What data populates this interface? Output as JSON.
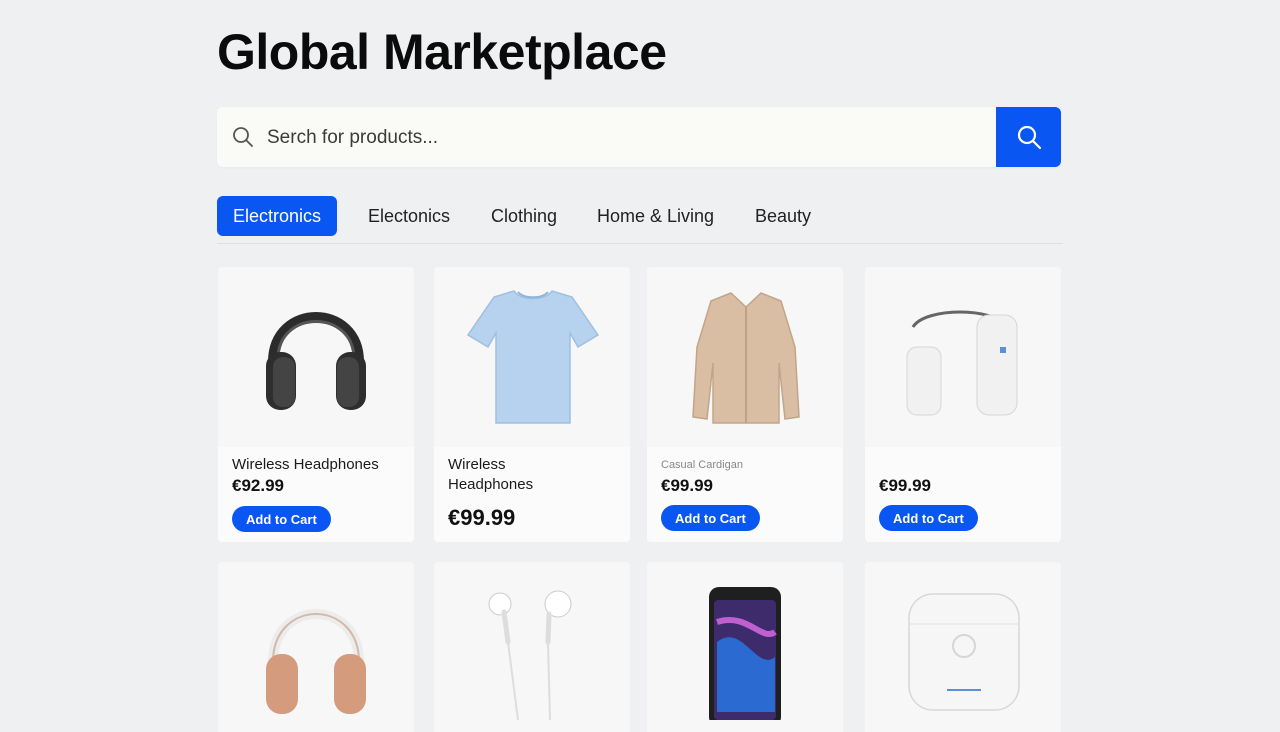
{
  "header": {
    "title": "Global Marketplace"
  },
  "search": {
    "placeholder": "Serch for products...",
    "button_icon": "search-icon"
  },
  "tabs": [
    {
      "label": "Electronics",
      "active": true
    },
    {
      "label": "Electonics",
      "active": false
    },
    {
      "label": "Clothing",
      "active": false
    },
    {
      "label": "Home & Living",
      "active": false
    },
    {
      "label": "Beauty",
      "active": false
    }
  ],
  "products": [
    {
      "name": "Wireless Headphones",
      "price": "€92.99",
      "cart_label": "Add to Cart",
      "image": "over-ear-headphones-black"
    },
    {
      "name": "Wireless Headphones",
      "price": "€99.99",
      "image": "light-blue-t-shirt"
    },
    {
      "name": "Casual Cardigan",
      "price": "€99.99",
      "cart_label": "Add to Cart",
      "image": "beige-cardigan"
    },
    {
      "name": "",
      "price": "€99.99",
      "cart_label": "Add to Cart",
      "image": "white-neckband-earbuds"
    },
    {
      "name": "",
      "price": "",
      "image": "over-ear-headphones-rose"
    },
    {
      "name": "",
      "price": "",
      "image": "wired-earphones-white"
    },
    {
      "name": "",
      "price": "",
      "image": "smartphone"
    },
    {
      "name": "",
      "price": "",
      "image": "earbuds-charging-case"
    }
  ],
  "colors": {
    "accent": "#0a56f2",
    "background": "#eef0f2",
    "card": "#fbfbfb"
  }
}
